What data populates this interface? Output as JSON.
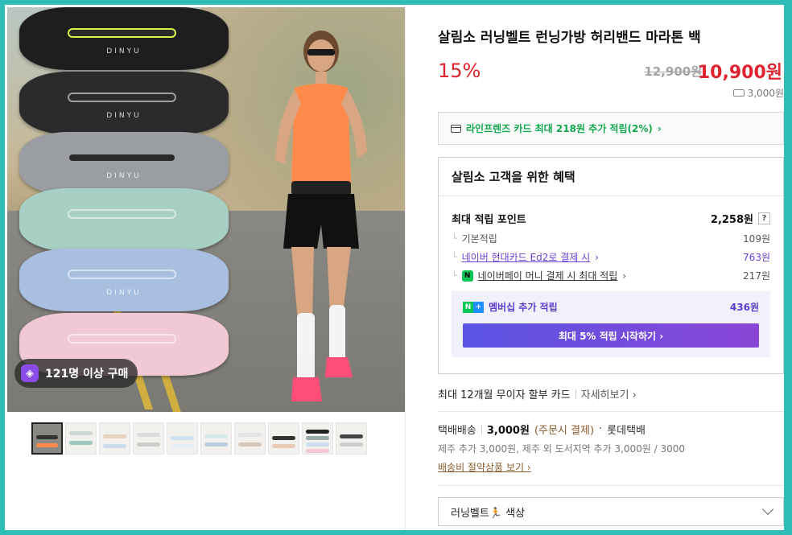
{
  "product": {
    "title": "살림소 러닝벨트 런닝가방 허리밴드 마라톤 백",
    "discount": "15%",
    "original_price": "12,900원",
    "sale_price": "10,900원",
    "shipping_fee_short": "3,000원"
  },
  "image": {
    "badge_text": "121명 이상 구매",
    "belt_logo": "DINYU",
    "thumbnails_count": 10
  },
  "card_promo": {
    "text": "라인프렌즈 카드 최대 218원 추가 적립(2%)",
    "arrow": "›"
  },
  "benefit": {
    "title": "살림소 고객을 위한 혜택",
    "max_points_label": "최대 적립 포인트",
    "max_points_value": "2,258원",
    "help": "?",
    "rows": [
      {
        "label": "기본적립",
        "value": "109원"
      },
      {
        "label": "네이버 현대카드 Ed2로 결제 시",
        "value": "763원"
      },
      {
        "label": "네이버페이 머니 결제 시 최대 적립",
        "value": "217원"
      }
    ],
    "tree_mark": "└",
    "membership_label": "멤버십 추가 적립",
    "membership_value": "436원",
    "membership_button": "최대 5% 적립 시작하기 ›",
    "npay_icon": "N",
    "nplus_n": "N",
    "nplus_plus": "+"
  },
  "installment": {
    "text": "최대 12개월 무이자 할부 카드",
    "more": "자세히보기 ›"
  },
  "shipping": {
    "method": "택배배송",
    "fee": "3,000원",
    "condition": "(주문시 결제)",
    "dot": "·",
    "carrier": "롯데택배",
    "extra": "제주 추가 3,000원, 제주 외 도서지역 추가 3,000원 / 3000",
    "link": "배송비 절약상품 보기 ›"
  },
  "option_select": {
    "label": "러닝벨트🏃 색상"
  },
  "colors": {
    "price_red": "#e0242f",
    "naver_green": "#12a84e",
    "purple": "#6b3fd8"
  }
}
